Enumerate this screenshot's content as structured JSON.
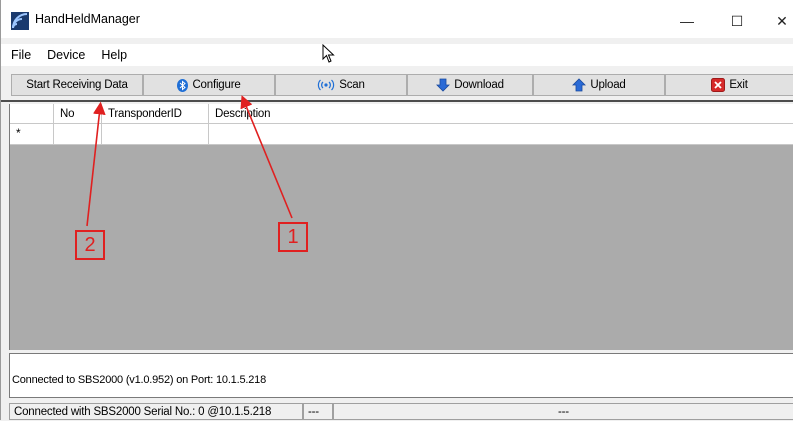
{
  "window": {
    "title": "HandHeldManager"
  },
  "window_controls": {
    "minimize": "—",
    "maximize": "☐",
    "close": "✕"
  },
  "menu": [
    "File",
    "Device",
    "Help"
  ],
  "toolbar": {
    "start_receiving": "Start Receiving Data",
    "configure": "Configure",
    "scan": "Scan",
    "download": "Download",
    "upload": "Upload",
    "exit": "Exit"
  },
  "grid": {
    "columns": [
      "",
      "No",
      "TransponderID",
      "Description"
    ],
    "new_row_marker": "*"
  },
  "status_box": {
    "text": "Connected to SBS2000 (v1.0.952)  on Port: 10.1.5.218"
  },
  "status_bar": {
    "connection": "Connected with SBS2000  Serial No.: 0  @10.1.5.218",
    "panel2": "---",
    "panel3": "---"
  },
  "annotations": {
    "callout_1": "1",
    "callout_2": "2"
  },
  "colors": {
    "annotation": "#e02020",
    "grid_background": "#ababab",
    "toolbar_border": "#4d4d4d"
  },
  "icons": [
    "app-icon",
    "bluetooth-icon",
    "wireless-icon",
    "download-arrow-icon",
    "upload-arrow-icon",
    "exit-icon",
    "cursor-icon"
  ]
}
